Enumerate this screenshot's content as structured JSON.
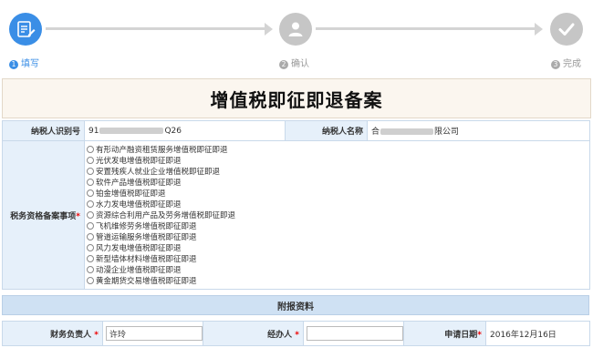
{
  "stepper": {
    "steps": [
      {
        "number": "1",
        "label": "填写",
        "state": "active"
      },
      {
        "number": "2",
        "label": "确认",
        "state": "inactive"
      },
      {
        "number": "3",
        "label": "完成",
        "state": "inactive"
      }
    ]
  },
  "title": "增值税即征即退备案",
  "taxpayer": {
    "id_label": "纳税人识别号",
    "id_prefix": "91",
    "id_suffix": "Q26",
    "name_label": "纳税人名称",
    "name_prefix": "合",
    "name_suffix": "限公司"
  },
  "qualification": {
    "label": "税务资格备案事项",
    "required_mark": "*",
    "options": [
      "有形动产融资租赁服务增值税即征即退",
      "光伏发电增值税即征即退",
      "安置残疾人就业企业增值税即征即退",
      "软件产品增值税即征即退",
      "铂金增值税即征即退",
      "水力发电增值税即征即退",
      "资源综合利用产品及劳务增值税即征即退",
      "飞机维修劳务增值税即征即退",
      "管道运输服务增值税即征即退",
      "风力发电增值税即征即退",
      "新型墙体材料增值税即征即退",
      "动漫企业增值税即征即退",
      "黄金期货交易增值税即征即退"
    ]
  },
  "attachments_heading": "附报资料",
  "bottom": {
    "finance_label": "财务负责人",
    "finance_value": "许玲",
    "handler_label": "经办人",
    "handler_value": "",
    "date_label": "申请日期",
    "date_value": "2016年12月16日",
    "required_mark": "*"
  },
  "colors": {
    "accent": "#3a8ee6",
    "label_bg": "#e6f0fa",
    "title_bg": "#fbf6ef",
    "required": "#e00000"
  }
}
